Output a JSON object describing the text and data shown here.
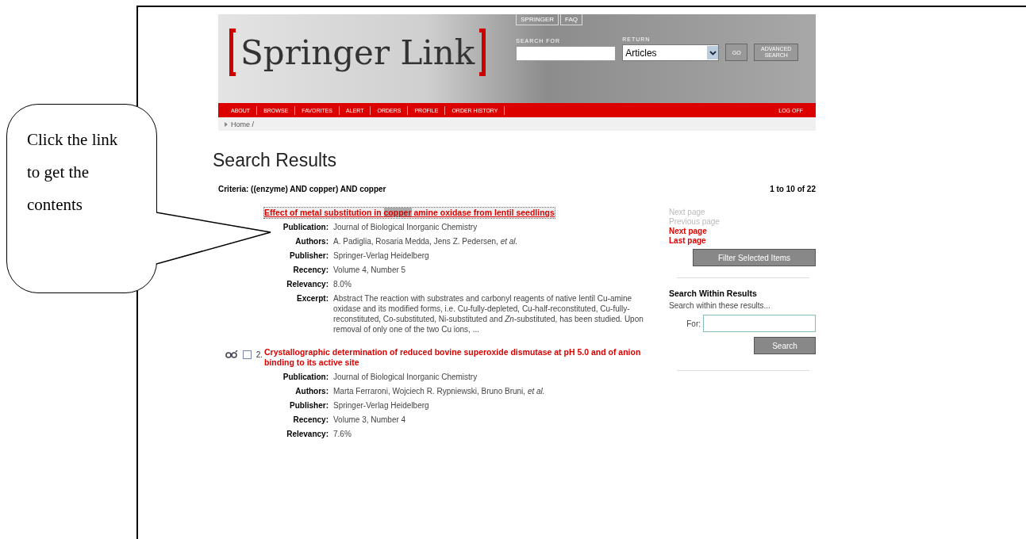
{
  "header": {
    "logo": "Springer Link",
    "top_tabs": [
      "SPRINGER",
      "FAQ"
    ],
    "search_for_label": "SEARCH FOR",
    "return_label": "RETURN",
    "return_value": "Articles",
    "go_button": "GO",
    "advanced_button": "ADVANCED SEARCH"
  },
  "nav": {
    "items": [
      "ABOUT",
      "BROWSE",
      "FAVORITES",
      "ALERT",
      "ORDERS",
      "PROFILE",
      "ORDER HISTORY"
    ],
    "logoff": "LOG OFF"
  },
  "breadcrumb": "Home /",
  "title": "Search Results",
  "criteria": "Criteria: ((enzyme) AND copper) AND copper",
  "range": "1 to 10 of 22",
  "results": [
    {
      "title_before": "Effect of metal substitution in ",
      "highlight": "copper",
      "title_after": " amine oxidase from lentil seedlings",
      "focused": true,
      "fields": [
        {
          "label": "Publication:",
          "value": "Journal of Biological Inorganic Chemistry"
        },
        {
          "label": "Authors:",
          "value": "A. Padiglia, Rosaria Medda, Jens Z. Pedersen, *et al.*"
        },
        {
          "label": "Publisher:",
          "value": "Springer-Verlag Heidelberg"
        },
        {
          "label": "Recency:",
          "value": "Volume 4, Number 5"
        },
        {
          "label": "Relevancy:",
          "value": "8.0%"
        },
        {
          "label": "Excerpt:",
          "value": "Abstract The reaction with substrates and carbonyl reagents of native lentil Cu-amine oxidase and its modified forms, i.e. Cu-fully-depleted, Cu-half-reconstituted, Cu-fully-reconstituted, Co-substituted, Ni-substituted and *Zn*-substituted, has been studied. Upon removal of only one of the two Cu ions, ..."
        }
      ]
    },
    {
      "number": "2.",
      "checked": false,
      "title_before": "Crystallographic determination of reduced bovine superoxide dismutase at pH 5.0 and of anion binding to its active site",
      "focused": false,
      "fields": [
        {
          "label": "Publication:",
          "value": "Journal of Biological Inorganic Chemistry"
        },
        {
          "label": "Authors:",
          "value": "Marta Ferraroni, Wojciech R. Rypniewski, Bruno Bruni, *et al.*"
        },
        {
          "label": "Publisher:",
          "value": "Springer-Verlag Heidelberg"
        },
        {
          "label": "Recency:",
          "value": "Volume 3, Number 4"
        },
        {
          "label": "Relevancy:",
          "value": "7.6%"
        }
      ]
    }
  ],
  "sidebar": {
    "pages": [
      {
        "label": "Next page",
        "disabled": true
      },
      {
        "label": "Previous page",
        "disabled": true
      },
      {
        "label": "Next page",
        "disabled": false
      },
      {
        "label": "Last page",
        "disabled": false
      }
    ],
    "filter_button": "Filter Selected Items",
    "within_heading": "Search Within Results",
    "within_hint": "Search within these results...",
    "for_label": "For:",
    "search_button": "Search"
  },
  "callout": {
    "text": "Click the link to get the contents"
  }
}
